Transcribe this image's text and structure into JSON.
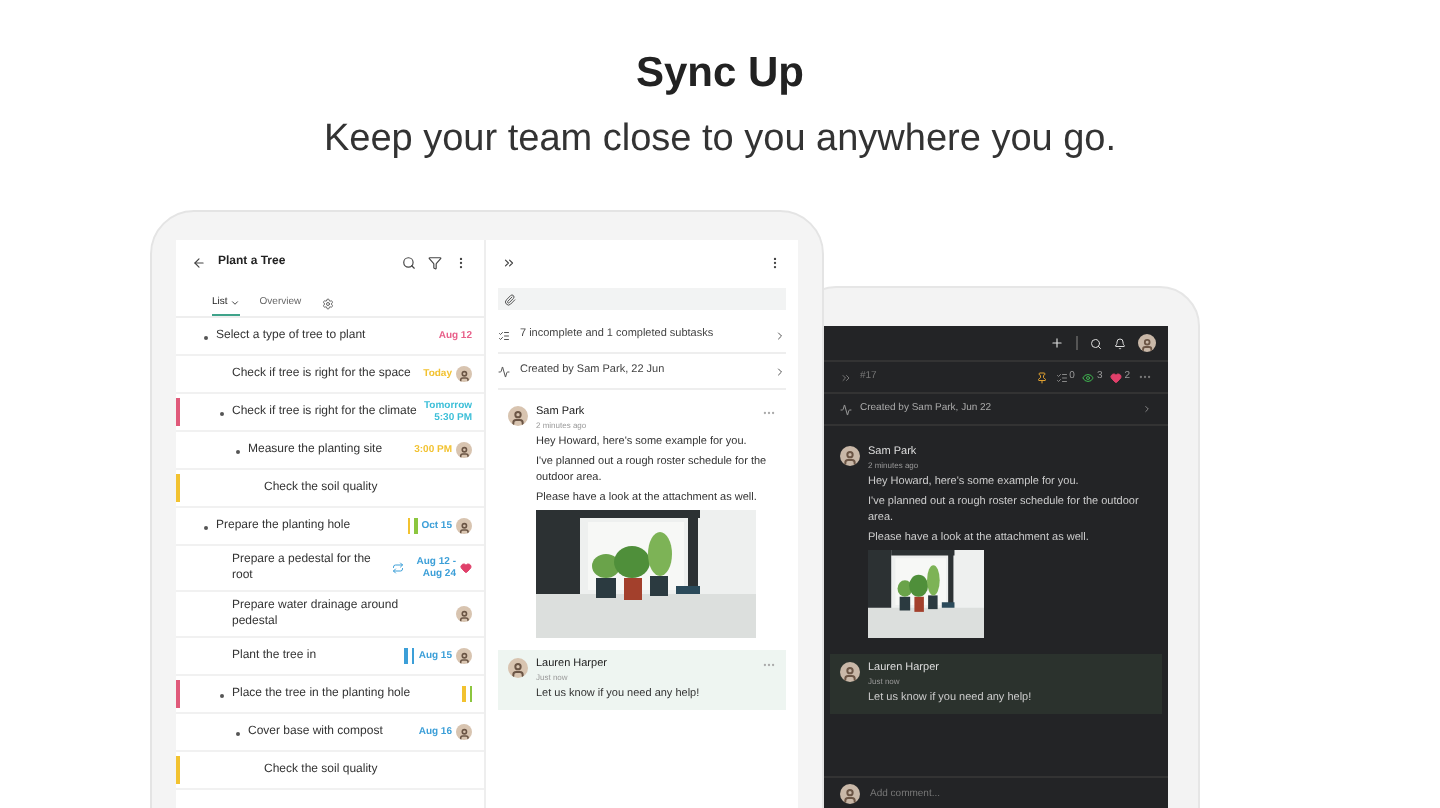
{
  "headline": "Sync Up",
  "subheadline": "Keep your team close to you anywhere you go.",
  "light_app": {
    "title": "Plant a Tree",
    "tabs": [
      {
        "label": "List",
        "selected": true
      },
      {
        "label": "Overview",
        "selected": false
      }
    ],
    "tasks": [
      {
        "title": "Select a type of tree to plant",
        "due": {
          "text": "Aug 12",
          "color": "#e8608a"
        },
        "children": [
          {
            "title": "Check if tree is right for the space",
            "due": {
              "text": "Today",
              "color": "#f2c230"
            },
            "avatar": true
          },
          {
            "title": "Check if tree is right for the climate",
            "due": {
              "text": "Tomorrow 5:30 PM",
              "color": "#3cbfd8"
            },
            "color": "#e05a7a",
            "children": [
              {
                "title": "Measure the planting site",
                "due": {
                  "text": "3:00 PM",
                  "color": "#f2c230"
                },
                "avatar": true,
                "children": [
                  {
                    "title": "Check the soil quality",
                    "color": "#f2c230"
                  }
                ]
              }
            ]
          }
        ]
      },
      {
        "title": "Prepare the planting hole",
        "due": {
          "text": "Oct 15",
          "color": "#3c9fd8"
        },
        "tags": [
          {
            "color": "#f2c230"
          },
          {
            "color": "#8cc63f"
          }
        ],
        "avatar": true,
        "children": [
          {
            "title": "Prepare a pedestal for the root",
            "due": {
              "text": "Aug 12 - Aug 24",
              "color": "#3c9fd8"
            },
            "repeat": true,
            "liked": true
          },
          {
            "title": "Prepare water drainage around pedestal",
            "avatar": true
          },
          {
            "title": "Plant the tree in",
            "due": {
              "text": "Aug 15",
              "color": "#3c9fd8"
            },
            "tags": [
              {
                "color": "#3c9fd8"
              },
              {
                "color": "#3c9fd8"
              }
            ],
            "avatar": true
          },
          {
            "title": "Place the tree in the planting hole",
            "color": "#e05a7a",
            "tags": [
              {
                "color": "#f2c230"
              },
              {
                "color": "#8cc63f"
              }
            ],
            "children": [
              {
                "title": "Cover base with compost",
                "due": {
                  "text": "Aug 16",
                  "color": "#3c9fd8"
                },
                "avatar": true,
                "children": [
                  {
                    "title": "Check the soil quality",
                    "color": "#f2c230"
                  }
                ]
              }
            ]
          }
        ]
      }
    ],
    "subtasks": "7 incomplete and 1 completed subtasks",
    "created": "Created by Sam Park, 22 Jun",
    "comments": [
      {
        "author": "Sam Park",
        "time": "2 minutes ago",
        "highlighted": false,
        "paragraphs": [
          "Hey Howard, here's some example for you.",
          "I've planned out a rough roster schedule for the outdoor area.",
          "Please have a look at the attachment as well."
        ],
        "attachment": {
          "kind": "picture"
        }
      },
      {
        "author": "Lauren Harper",
        "time": "Just now",
        "highlighted": true,
        "paragraphs": [
          "Let us know if you need any help!"
        ]
      }
    ]
  },
  "dark_app": {
    "task_number": "#17",
    "counters": [
      {
        "kind": "checklist",
        "value": "0"
      },
      {
        "kind": "watchers",
        "value": "3"
      },
      {
        "kind": "likes",
        "value": "2"
      }
    ],
    "created": "Created by Sam Park, Jun 22",
    "comments": [
      {
        "author": "Sam Park",
        "time": "2 minutes ago",
        "highlighted": false,
        "paragraphs": [
          "Hey Howard, here's some example for you.",
          "I've planned out a rough roster schedule for the outdoor area.",
          "Please have a look at the attachment as well."
        ],
        "attachment": {
          "kind": "picture"
        }
      },
      {
        "author": "Lauren Harper",
        "time": "Just now",
        "highlighted": true,
        "paragraphs": [
          "Let us know if you need any help!"
        ]
      }
    ],
    "comment_placeholder": "Add comment..."
  }
}
